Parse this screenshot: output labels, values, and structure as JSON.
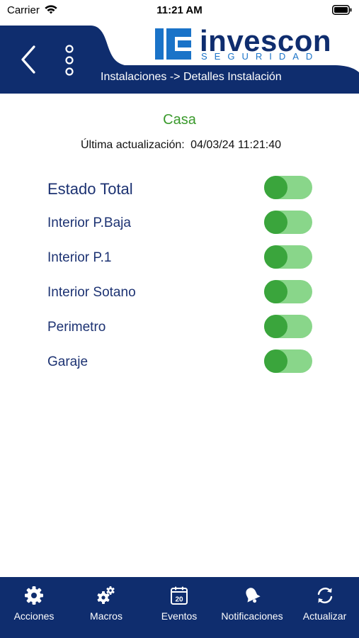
{
  "status_bar": {
    "carrier": "Carrier",
    "time": "11:21 AM"
  },
  "header": {
    "logo_text": "invescon",
    "logo_subtext": "SEGURIDAD",
    "breadcrumb": "Instalaciones -> Detalles Instalación",
    "colors": {
      "navy": "#0f2d6e",
      "logo_blue": "#1a73c8"
    }
  },
  "installation": {
    "name": "Casa",
    "last_update_label": "Última actualización:",
    "last_update_value": "04/03/24 11:21:40"
  },
  "zones": [
    {
      "label": "Estado Total",
      "on": true
    },
    {
      "label": "Interior P.Baja",
      "on": true
    },
    {
      "label": "Interior P.1",
      "on": true
    },
    {
      "label": "Interior Sotano",
      "on": true
    },
    {
      "label": "Perimetro",
      "on": true
    },
    {
      "label": "Garaje",
      "on": true
    }
  ],
  "tabs": [
    {
      "label": "Acciones",
      "icon": "gear-icon"
    },
    {
      "label": "Macros",
      "icon": "gears-icon"
    },
    {
      "label": "Eventos",
      "icon": "calendar-icon",
      "calendar_day": "20"
    },
    {
      "label": "Notificaciones",
      "icon": "bell-icon"
    },
    {
      "label": "Actualizar",
      "icon": "refresh-icon"
    }
  ],
  "colors": {
    "accent_green": "#3aa53c",
    "toggle_track": "#89d68a",
    "site_name": "#3a9a2c",
    "zone_text": "#1c3272"
  }
}
